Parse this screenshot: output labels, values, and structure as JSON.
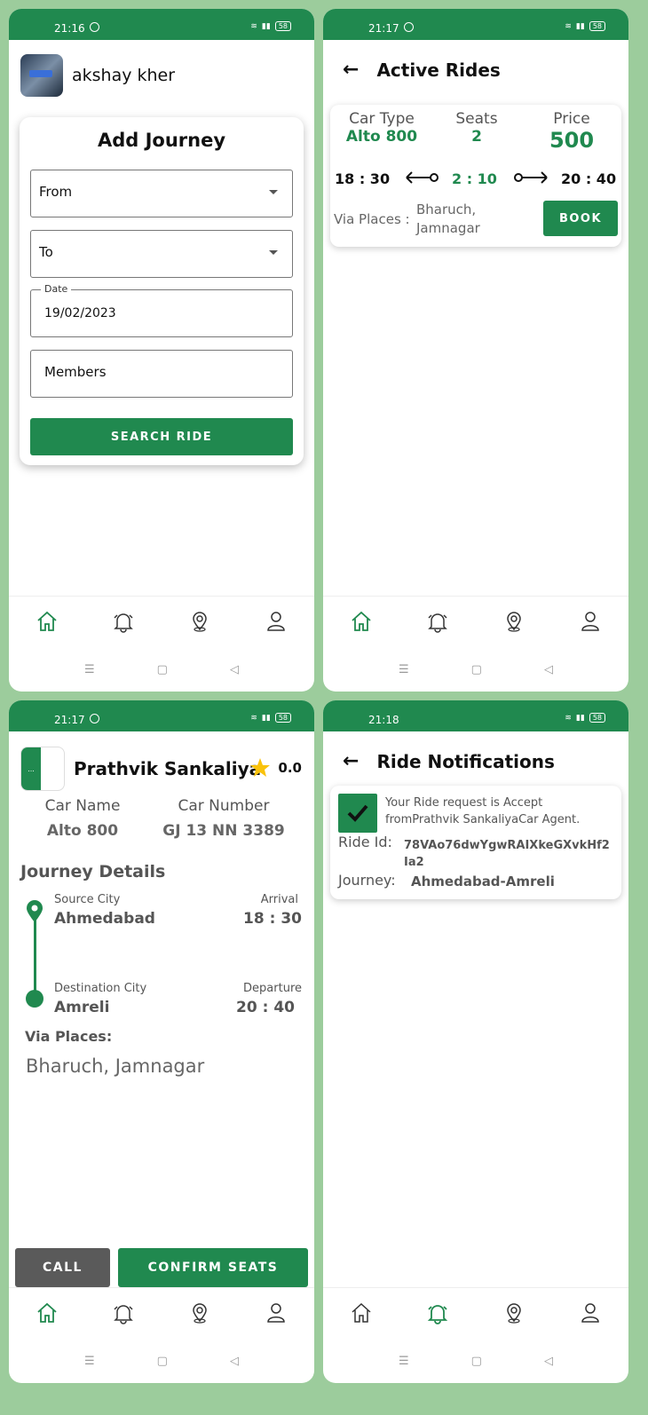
{
  "colors": {
    "primary": "#20894f",
    "background": "#9ccc9c"
  },
  "screens": {
    "add_journey": {
      "status_time": "21:16",
      "battery": "58",
      "user_name": "akshay kher",
      "card_title": "Add Journey",
      "from_placeholder": "From",
      "to_placeholder": "To",
      "date_label": "Date",
      "date_value": "19/02/2023",
      "members_placeholder": "Members",
      "search_button": "SEARCH RIDE"
    },
    "active_rides": {
      "status_time": "21:17",
      "battery": "58",
      "title": "Active Rides",
      "car_type_label": "Car Type",
      "car_type_value": "Alto 800",
      "seats_label": "Seats",
      "seats_value": "2",
      "price_label": "Price",
      "price_value": "500",
      "departure_time": "18 : 30",
      "duration": "2 : 10",
      "arrival_time": "20 : 40",
      "via_label": "Via Places :",
      "via_value": "Bharuch, Jamnagar",
      "book_button": "BOOK"
    },
    "ride_details": {
      "status_time": "21:17",
      "battery": "58",
      "logo_text": "...",
      "driver_name": "Prathvik Sankaliya",
      "rating": "0.0",
      "car_name_label": "Car Name",
      "car_name_value": "Alto 800",
      "car_number_label": "Car Number",
      "car_number_value": "GJ 13 NN 3389",
      "journey_title": "Journey Details",
      "source_label": "Source City",
      "source_value": "Ahmedabad",
      "arrival_label": "Arrival",
      "arrival_value": "18 : 30",
      "destination_label": "Destination City",
      "destination_value": "Amreli",
      "departure_label": "Departure",
      "departure_value": "20 : 40",
      "via_label": "Via Places:",
      "via_value": "Bharuch, Jamnagar",
      "call_button": "CALL",
      "confirm_button": "CONFIRM SEATS"
    },
    "notifications": {
      "status_time": "21:18",
      "battery": "58",
      "title": "Ride Notifications",
      "message": "Your Ride request is Accept fromPrathvik SankaliyaCar Agent.",
      "ride_id_label": "Ride Id:",
      "ride_id_value": "78VAo76dwYgwRAIXkeGXvkHf2Ia2",
      "journey_label": "Journey:",
      "journey_value": "Ahmedabad-Amreli"
    }
  },
  "nav_icons": [
    "home-icon",
    "bell-icon",
    "location-icon",
    "profile-icon"
  ]
}
